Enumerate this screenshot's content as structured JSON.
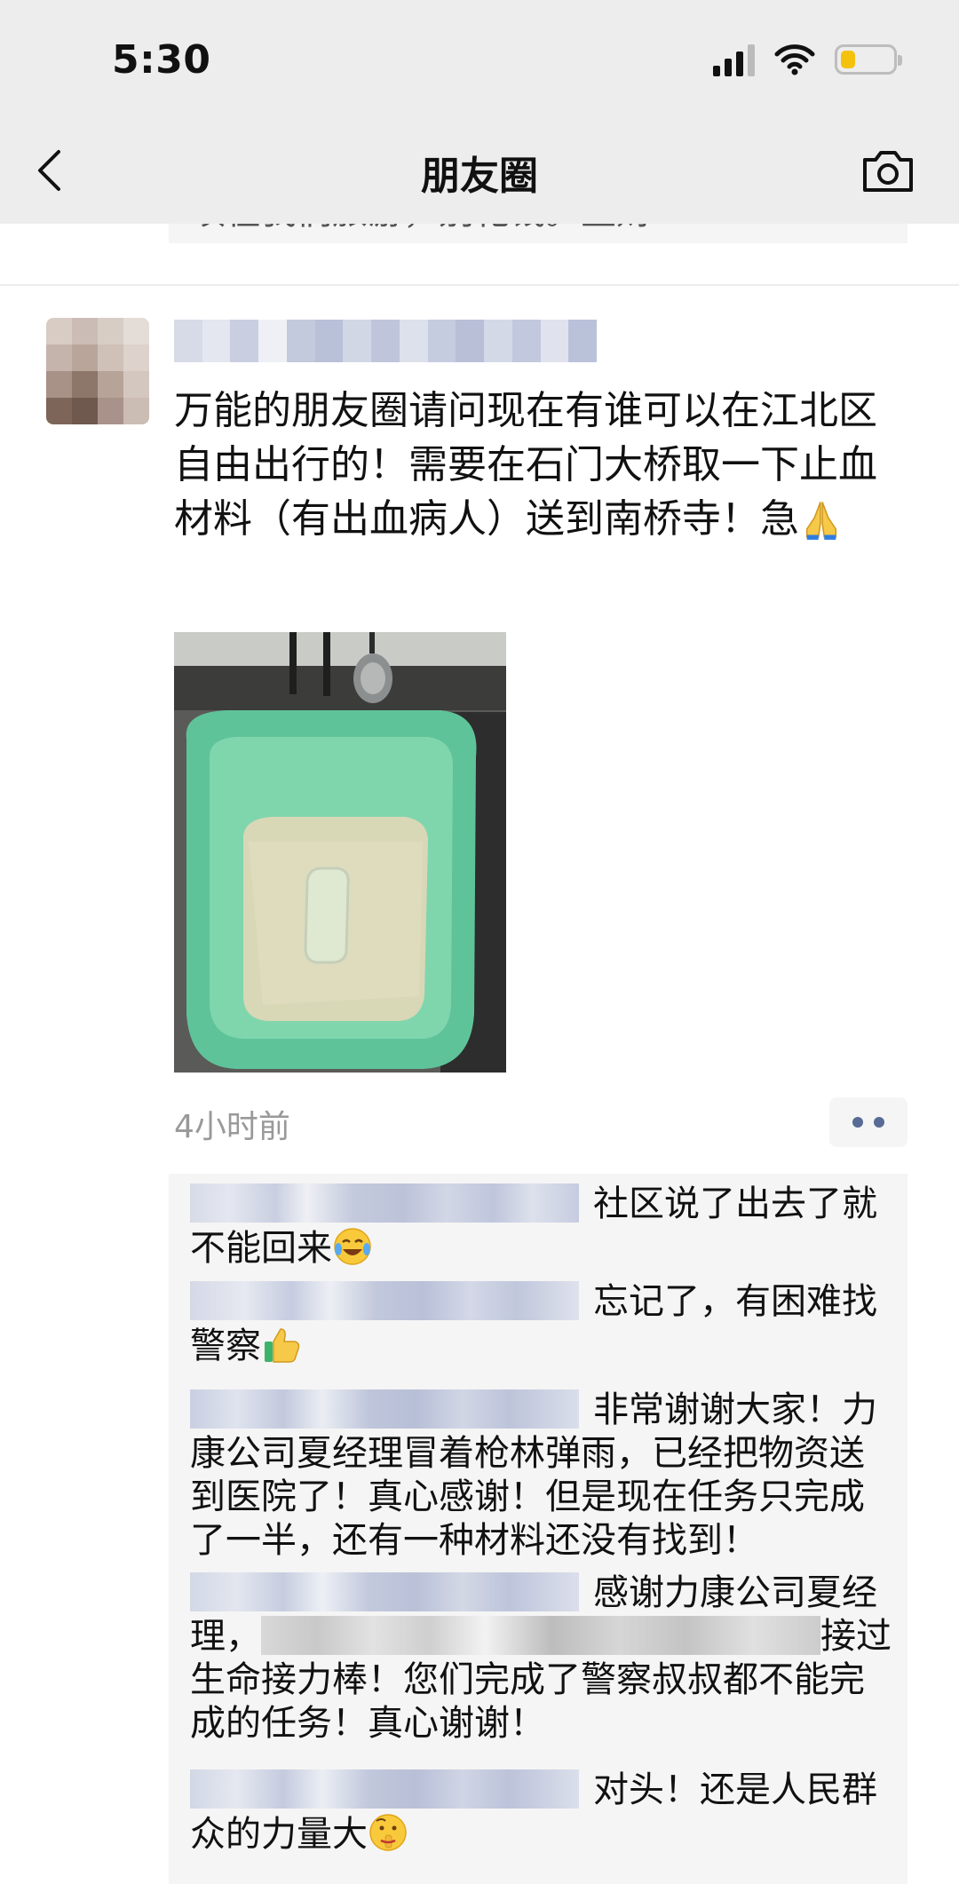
{
  "status_bar": {
    "time": "5:30"
  },
  "nav": {
    "title": "朋友圈"
  },
  "prev_post": {
    "partial_text": "项在我们旅游，别花钱。生财"
  },
  "post": {
    "text": "万能的朋友圈请问现在有谁可以在江北区自由出行的！需要在石门大桥取一下止血材料（有出血病人）送到南桥寺！急",
    "time": "4小时前"
  },
  "comments": [
    {
      "text": "社区说了出去了就不能回来"
    },
    {
      "text": "忘记了，有困难找警察"
    },
    {
      "text": "非常谢谢大家！力康公司夏经理冒着枪林弹雨，已经把物资送到医院了！真心感谢！但是现在任务只完成了一半，还有一种材料还没有找到！"
    },
    {
      "text_a": "感谢力康公司夏经理，",
      "text_b": "接过生命接力棒！您们完成了警察叔叔都不能完成的任务！真心谢谢！"
    },
    {
      "text": "对头！还是人民群众的力量大"
    }
  ],
  "colors": {
    "topbar": "#ededed",
    "link": "#576b95",
    "comment_bg": "#f5f5f5",
    "battery": "#f4c20d"
  }
}
